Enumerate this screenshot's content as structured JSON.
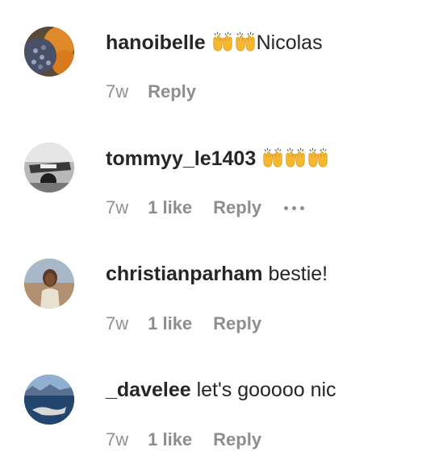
{
  "comments": [
    {
      "username": "hanoibelle",
      "text": "Nicolas",
      "emoji_prefix": "raising-hands-emoji-x2",
      "time": "7w",
      "likes": "",
      "reply": "Reply"
    },
    {
      "username": "tommyy_le1403",
      "text": "",
      "emoji_suffix": "raising-hands-emoji-x3",
      "time": "7w",
      "likes": "1 like",
      "reply": "Reply"
    },
    {
      "username": "christianparham",
      "text": "bestie!",
      "time": "7w",
      "likes": "1 like",
      "reply": "Reply"
    },
    {
      "username": "_davelee",
      "text": "let's gooooo nic",
      "time": "7w",
      "likes": "1 like",
      "reply": "Reply"
    }
  ],
  "colors": {
    "text": "#262626",
    "secondary": "#8e8e8e",
    "emoji": "#f5b82e"
  },
  "icons": [
    "more-options-icon",
    "raising-hands-emoji"
  ]
}
